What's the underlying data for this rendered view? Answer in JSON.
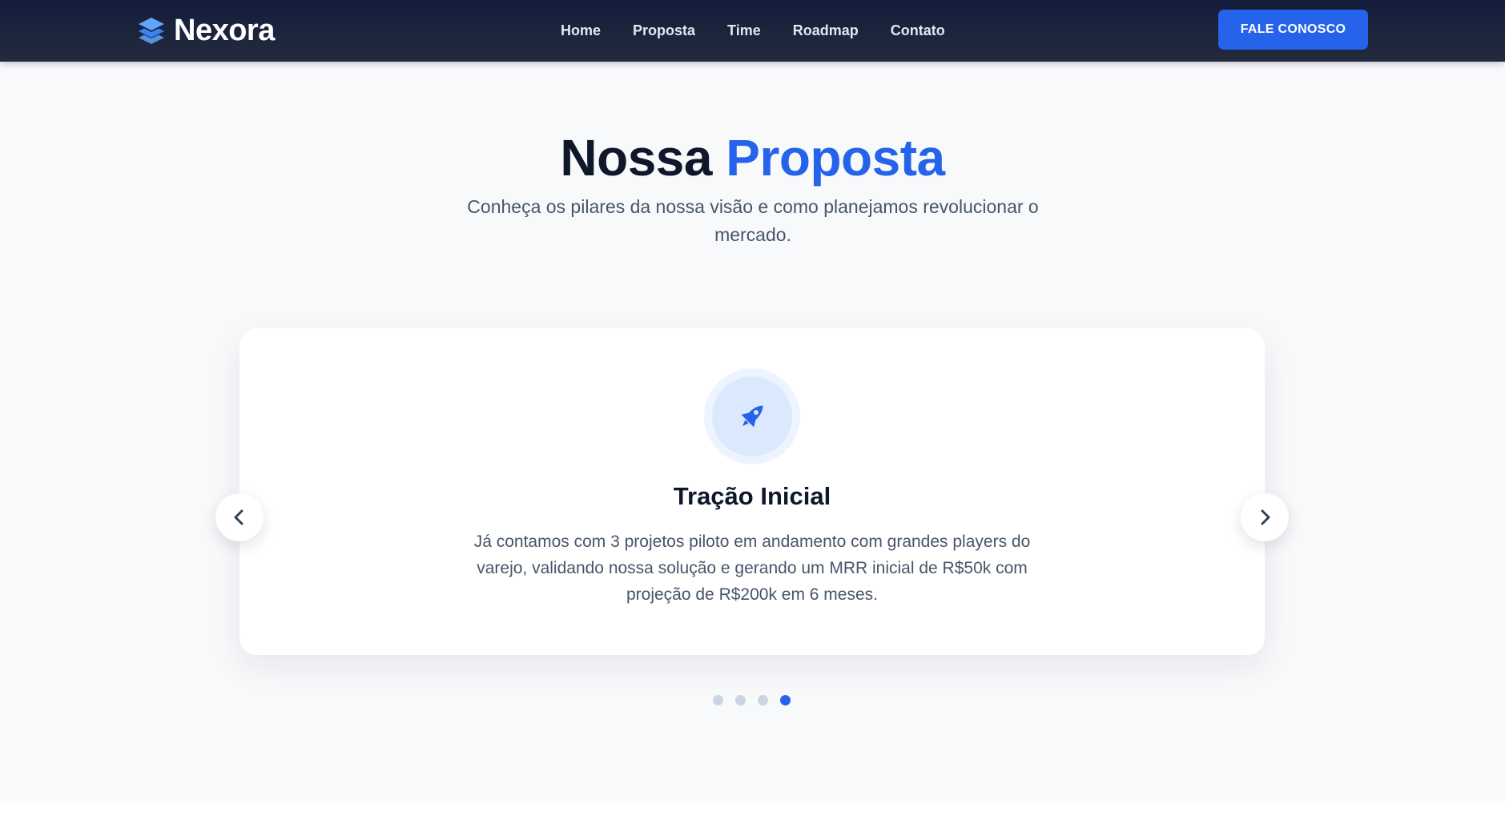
{
  "brand": {
    "name": "Nexora",
    "logo_icon": "stacked-layers-icon"
  },
  "nav": {
    "links": [
      {
        "label": "Home"
      },
      {
        "label": "Proposta"
      },
      {
        "label": "Time"
      },
      {
        "label": "Roadmap"
      },
      {
        "label": "Contato"
      }
    ],
    "cta_label": "FALE CONOSCO"
  },
  "section": {
    "title_part1": "Nossa",
    "title_part2": "Proposta",
    "subtitle": "Conheça os pilares da nossa visão e como planejamos revolucionar o mercado."
  },
  "slide": {
    "icon": "rocket-icon",
    "title": "Tração Inicial",
    "text": "Já contamos com 3 projetos piloto em andamento com grandes players do varejo, validando nossa solução e gerando um MRR inicial de R$50k com projeção de R$200k em 6 meses."
  },
  "carousel": {
    "total_slides": 4,
    "active_index": 4,
    "prev_icon": "chevron-left-icon",
    "next_icon": "chevron-right-icon"
  },
  "colors": {
    "accent": "#2563eb",
    "nav_bg": "#1b2339",
    "section_bg": "#f8f9fb",
    "heading": "#0f172a",
    "body_text": "#475569"
  }
}
